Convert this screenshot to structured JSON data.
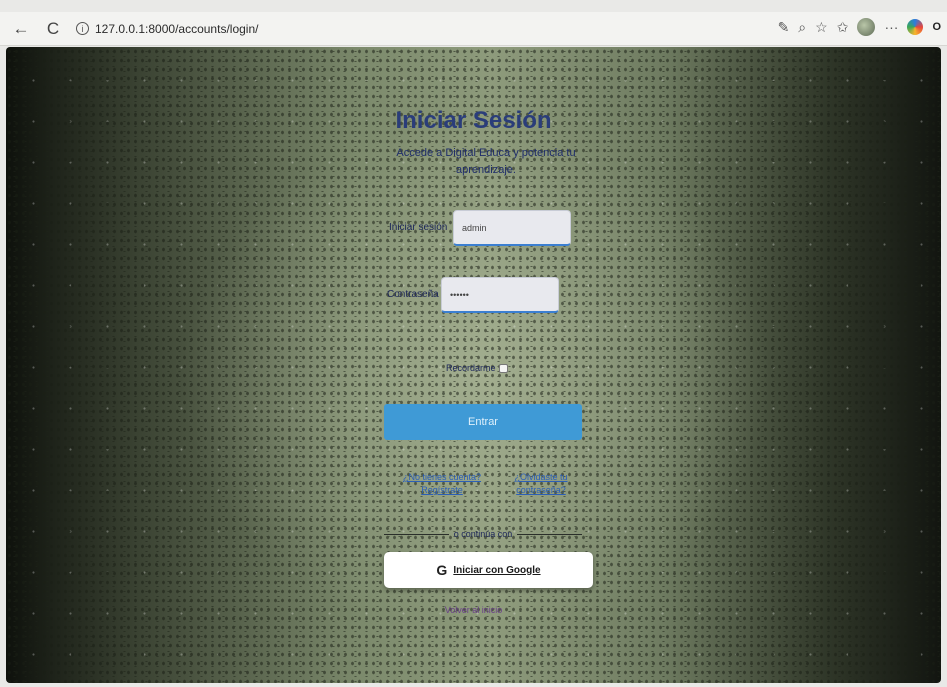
{
  "browser": {
    "back_icon": "←",
    "reload_icon": "C",
    "info_icon": "i",
    "url": "127.0.0.1:8000/accounts/login/",
    "toolbar_icons": [
      "✎",
      "⌕",
      "☆",
      "✩"
    ],
    "menu_icon": "···",
    "copilot_label": "O"
  },
  "login": {
    "title": "Iniciar Sesión",
    "subtitle": "Accede a Digital Educa y potencia tu aprendizaje.",
    "username_label": "Iniciar sesión",
    "username_value": "admin",
    "password_label": "Contraseña",
    "password_value": "••••••",
    "remember_label": "Recordarme",
    "submit_label": "Entrar",
    "links": {
      "forgot": "¿Olvidaste tu contraseña?",
      "register": "¿No tienes cuenta? Regístrate"
    },
    "divider_text": "o continúa con",
    "google_icon": "G",
    "google_label": "Iniciar con Google",
    "bottom_link": "Volver al inicio"
  },
  "colors": {
    "title": "#2a3d7a",
    "button": "#3f9ad6",
    "link": "#2b5fb8"
  }
}
